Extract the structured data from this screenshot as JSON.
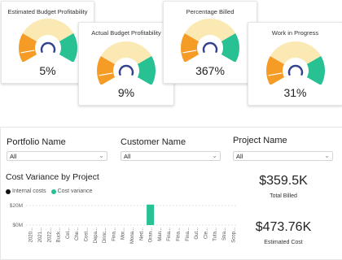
{
  "gauges": [
    {
      "title": "Estimated Budget Profitability",
      "value": "5%"
    },
    {
      "title": "Actual Budget Profitability",
      "value": "9%"
    },
    {
      "title": "Percentage Billed",
      "value": "367%"
    },
    {
      "title": "Work in Progress",
      "value": "31%"
    }
  ],
  "colors": {
    "orange": "#f59c27",
    "yellow": "#fbe9b3",
    "green": "#27c193",
    "needle": "#33418e",
    "black": "#111111"
  },
  "slicers": [
    {
      "title": "Portfolio Name",
      "value": "All"
    },
    {
      "title": "Customer Name",
      "value": "All"
    },
    {
      "title": "Project Name",
      "value": "All"
    }
  ],
  "chart": {
    "title": "Cost Variance by Project",
    "legend": [
      {
        "name": "Internal costs",
        "color": "#111111"
      },
      {
        "name": "Cost variance",
        "color": "#27c193"
      }
    ]
  },
  "chart_data": {
    "type": "bar",
    "title": "Cost Variance by Project",
    "y_ticks": [
      "$20M",
      "$0M"
    ],
    "ylim": [
      0,
      20
    ],
    "categories": [
      "2020...",
      "2021...",
      "2022...",
      "Buck...",
      "Cel...",
      "Che...",
      "Cost...",
      "Depa...",
      "Drinc...",
      "Fina...",
      "Mor...",
      "Mona...",
      "Ned...",
      "Oran...",
      "Man...",
      "Fina...",
      "Fina...",
      "Fina...",
      "Gut...",
      "Cle...",
      "Tuta...",
      "Stra...",
      "Scop..."
    ],
    "series": [
      {
        "name": "Internal costs",
        "values": [
          0,
          0,
          0,
          0,
          0,
          0,
          0,
          0,
          0,
          0,
          0,
          0,
          0,
          0,
          0,
          0,
          0,
          0,
          0,
          0,
          0,
          0,
          0
        ]
      },
      {
        "name": "Cost variance",
        "values": [
          0,
          0,
          0,
          0,
          0,
          0,
          0,
          0,
          0,
          0,
          0,
          0,
          0,
          21,
          0,
          0,
          0,
          0,
          0,
          0,
          0,
          0,
          0
        ]
      }
    ]
  },
  "kpis": [
    {
      "value": "$359.5K",
      "label": "Total Billed"
    },
    {
      "value": "$473.76K",
      "label": "Estimated Cost"
    }
  ]
}
